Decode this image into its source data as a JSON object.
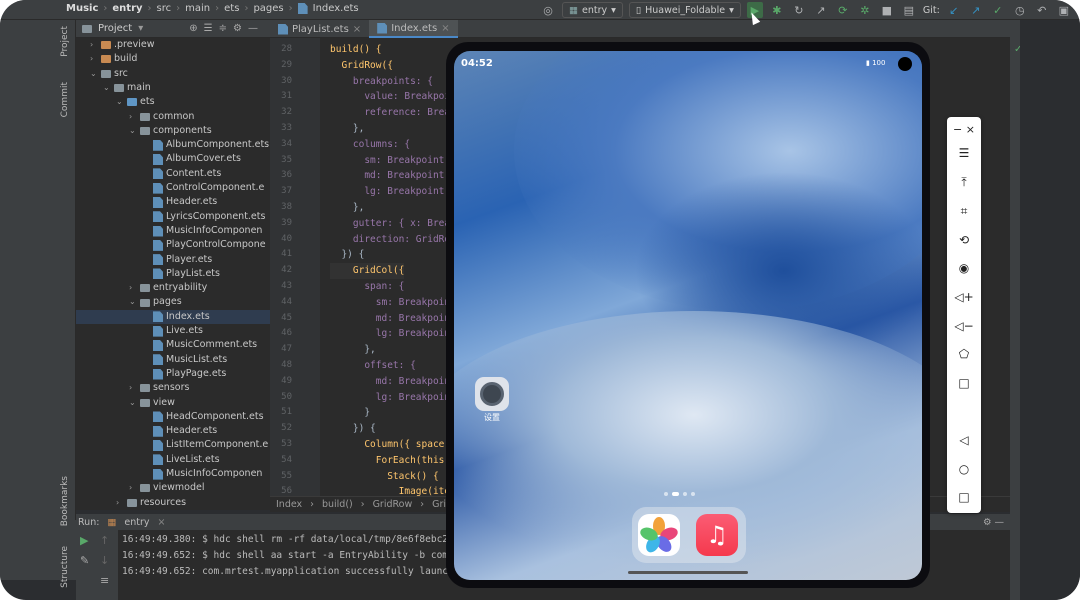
{
  "topbar": {
    "breadcrumbs": [
      "Music",
      "entry",
      "src",
      "main",
      "ets",
      "pages",
      "Index.ets"
    ],
    "run_config": "entry",
    "device": "Huawei_Foldable",
    "git_label": "Git:"
  },
  "project_panel": {
    "title": "Project",
    "tree": [
      {
        "label": ".preview",
        "indent": 2,
        "kind": "folder-orange",
        "arrow": "›"
      },
      {
        "label": "build",
        "indent": 2,
        "kind": "folder-orange",
        "arrow": "›"
      },
      {
        "label": "src",
        "indent": 2,
        "kind": "folder",
        "arrow": "⌄"
      },
      {
        "label": "main",
        "indent": 3,
        "kind": "folder",
        "arrow": "⌄"
      },
      {
        "label": "ets",
        "indent": 4,
        "kind": "folder-blue",
        "arrow": "⌄"
      },
      {
        "label": "common",
        "indent": 5,
        "kind": "folder",
        "arrow": "›"
      },
      {
        "label": "components",
        "indent": 5,
        "kind": "folder",
        "arrow": "⌄"
      },
      {
        "label": "AlbumComponent.ets",
        "indent": 6,
        "kind": "file",
        "arrow": ""
      },
      {
        "label": "AlbumCover.ets",
        "indent": 6,
        "kind": "file",
        "arrow": ""
      },
      {
        "label": "Content.ets",
        "indent": 6,
        "kind": "file",
        "arrow": ""
      },
      {
        "label": "ControlComponent.e",
        "indent": 6,
        "kind": "file",
        "arrow": ""
      },
      {
        "label": "Header.ets",
        "indent": 6,
        "kind": "file",
        "arrow": ""
      },
      {
        "label": "LyricsComponent.ets",
        "indent": 6,
        "kind": "file",
        "arrow": ""
      },
      {
        "label": "MusicInfoComponen",
        "indent": 6,
        "kind": "file",
        "arrow": ""
      },
      {
        "label": "PlayControlCompone",
        "indent": 6,
        "kind": "file",
        "arrow": ""
      },
      {
        "label": "Player.ets",
        "indent": 6,
        "kind": "file",
        "arrow": ""
      },
      {
        "label": "PlayList.ets",
        "indent": 6,
        "kind": "file",
        "arrow": ""
      },
      {
        "label": "entryability",
        "indent": 5,
        "kind": "folder",
        "arrow": "›"
      },
      {
        "label": "pages",
        "indent": 5,
        "kind": "folder",
        "arrow": "⌄"
      },
      {
        "label": "Index.ets",
        "indent": 6,
        "kind": "file",
        "arrow": "",
        "selected": true
      },
      {
        "label": "Live.ets",
        "indent": 6,
        "kind": "file",
        "arrow": ""
      },
      {
        "label": "MusicComment.ets",
        "indent": 6,
        "kind": "file",
        "arrow": ""
      },
      {
        "label": "MusicList.ets",
        "indent": 6,
        "kind": "file",
        "arrow": ""
      },
      {
        "label": "PlayPage.ets",
        "indent": 6,
        "kind": "file",
        "arrow": ""
      },
      {
        "label": "sensors",
        "indent": 5,
        "kind": "folder",
        "arrow": "›"
      },
      {
        "label": "view",
        "indent": 5,
        "kind": "folder",
        "arrow": "⌄"
      },
      {
        "label": "HeadComponent.ets",
        "indent": 6,
        "kind": "file",
        "arrow": ""
      },
      {
        "label": "Header.ets",
        "indent": 6,
        "kind": "file",
        "arrow": ""
      },
      {
        "label": "ListItemComponent.e",
        "indent": 6,
        "kind": "file",
        "arrow": ""
      },
      {
        "label": "LiveList.ets",
        "indent": 6,
        "kind": "file",
        "arrow": ""
      },
      {
        "label": "MusicInfoComponen",
        "indent": 6,
        "kind": "file",
        "arrow": ""
      },
      {
        "label": "viewmodel",
        "indent": 5,
        "kind": "folder",
        "arrow": "›"
      },
      {
        "label": "resources",
        "indent": 4,
        "kind": "folder",
        "arrow": "›"
      }
    ]
  },
  "side_tabs": [
    "Project",
    "Commit",
    "Bookmarks",
    "Structure"
  ],
  "editor": {
    "tabs": [
      {
        "label": "PlayList.ets",
        "active": false
      },
      {
        "label": "Index.ets",
        "active": true
      }
    ],
    "line_numbers": [
      "28",
      "29",
      "30",
      "31",
      "32",
      "33",
      "34",
      "35",
      "36",
      "37",
      "38",
      "39",
      "40",
      "41",
      "42",
      "43",
      "44",
      "45",
      "46",
      "47",
      "48",
      "49",
      "50",
      "51",
      "52",
      "53",
      "54",
      "55",
      "56"
    ],
    "lines": [
      "build() {",
      "  GridRow({",
      "    breakpoints: {",
      "      value: Breakpoi",
      "      reference: Brea",
      "    },",
      "    columns: {",
      "      sm: Breakpoint(",
      "      md: Breakpoint(",
      "      lg: Breakpoint(",
      "    },",
      "    gutter: { x: Brea",
      "    direction: GridRo",
      "  }) {",
      "    GridCol({",
      "      span: {",
      "        sm: Breakpoin",
      "        md: Breakpoin",
      "        lg: Breakpoin",
      "      },",
      "      offset: {",
      "        md: Breakpoin",
      "        lg: Breakpoin",
      "      }",
      "    }) {",
      "      Column({ space",
      "        ForEach(this.",
      "          Stack() {",
      "            Image(ite"
    ],
    "breadcrumb": [
      "Index",
      "build()",
      "GridRow",
      "GridCol"
    ]
  },
  "run_panel": {
    "label": "Run:",
    "config": "entry",
    "console": [
      "16:49:49.380: $ hdc shell rm -rf data/local/tmp/8e6f8ebc2",
      "16:49:49.652: $ hdc shell aa start -a EntryAbility -b com",
      "16:49:49.652: com.mrtest.myapplication successfully launc"
    ]
  },
  "emulator": {
    "time": "04:52",
    "battery": "100",
    "app_label": "设置",
    "dock_apps": [
      "gallery-app",
      "music-app"
    ]
  },
  "emulator_controls": [
    "menu",
    "pin",
    "crop",
    "rotate",
    "screenshot",
    "volume-up",
    "volume-down",
    "shake",
    "square",
    "back",
    "home",
    "recents"
  ]
}
